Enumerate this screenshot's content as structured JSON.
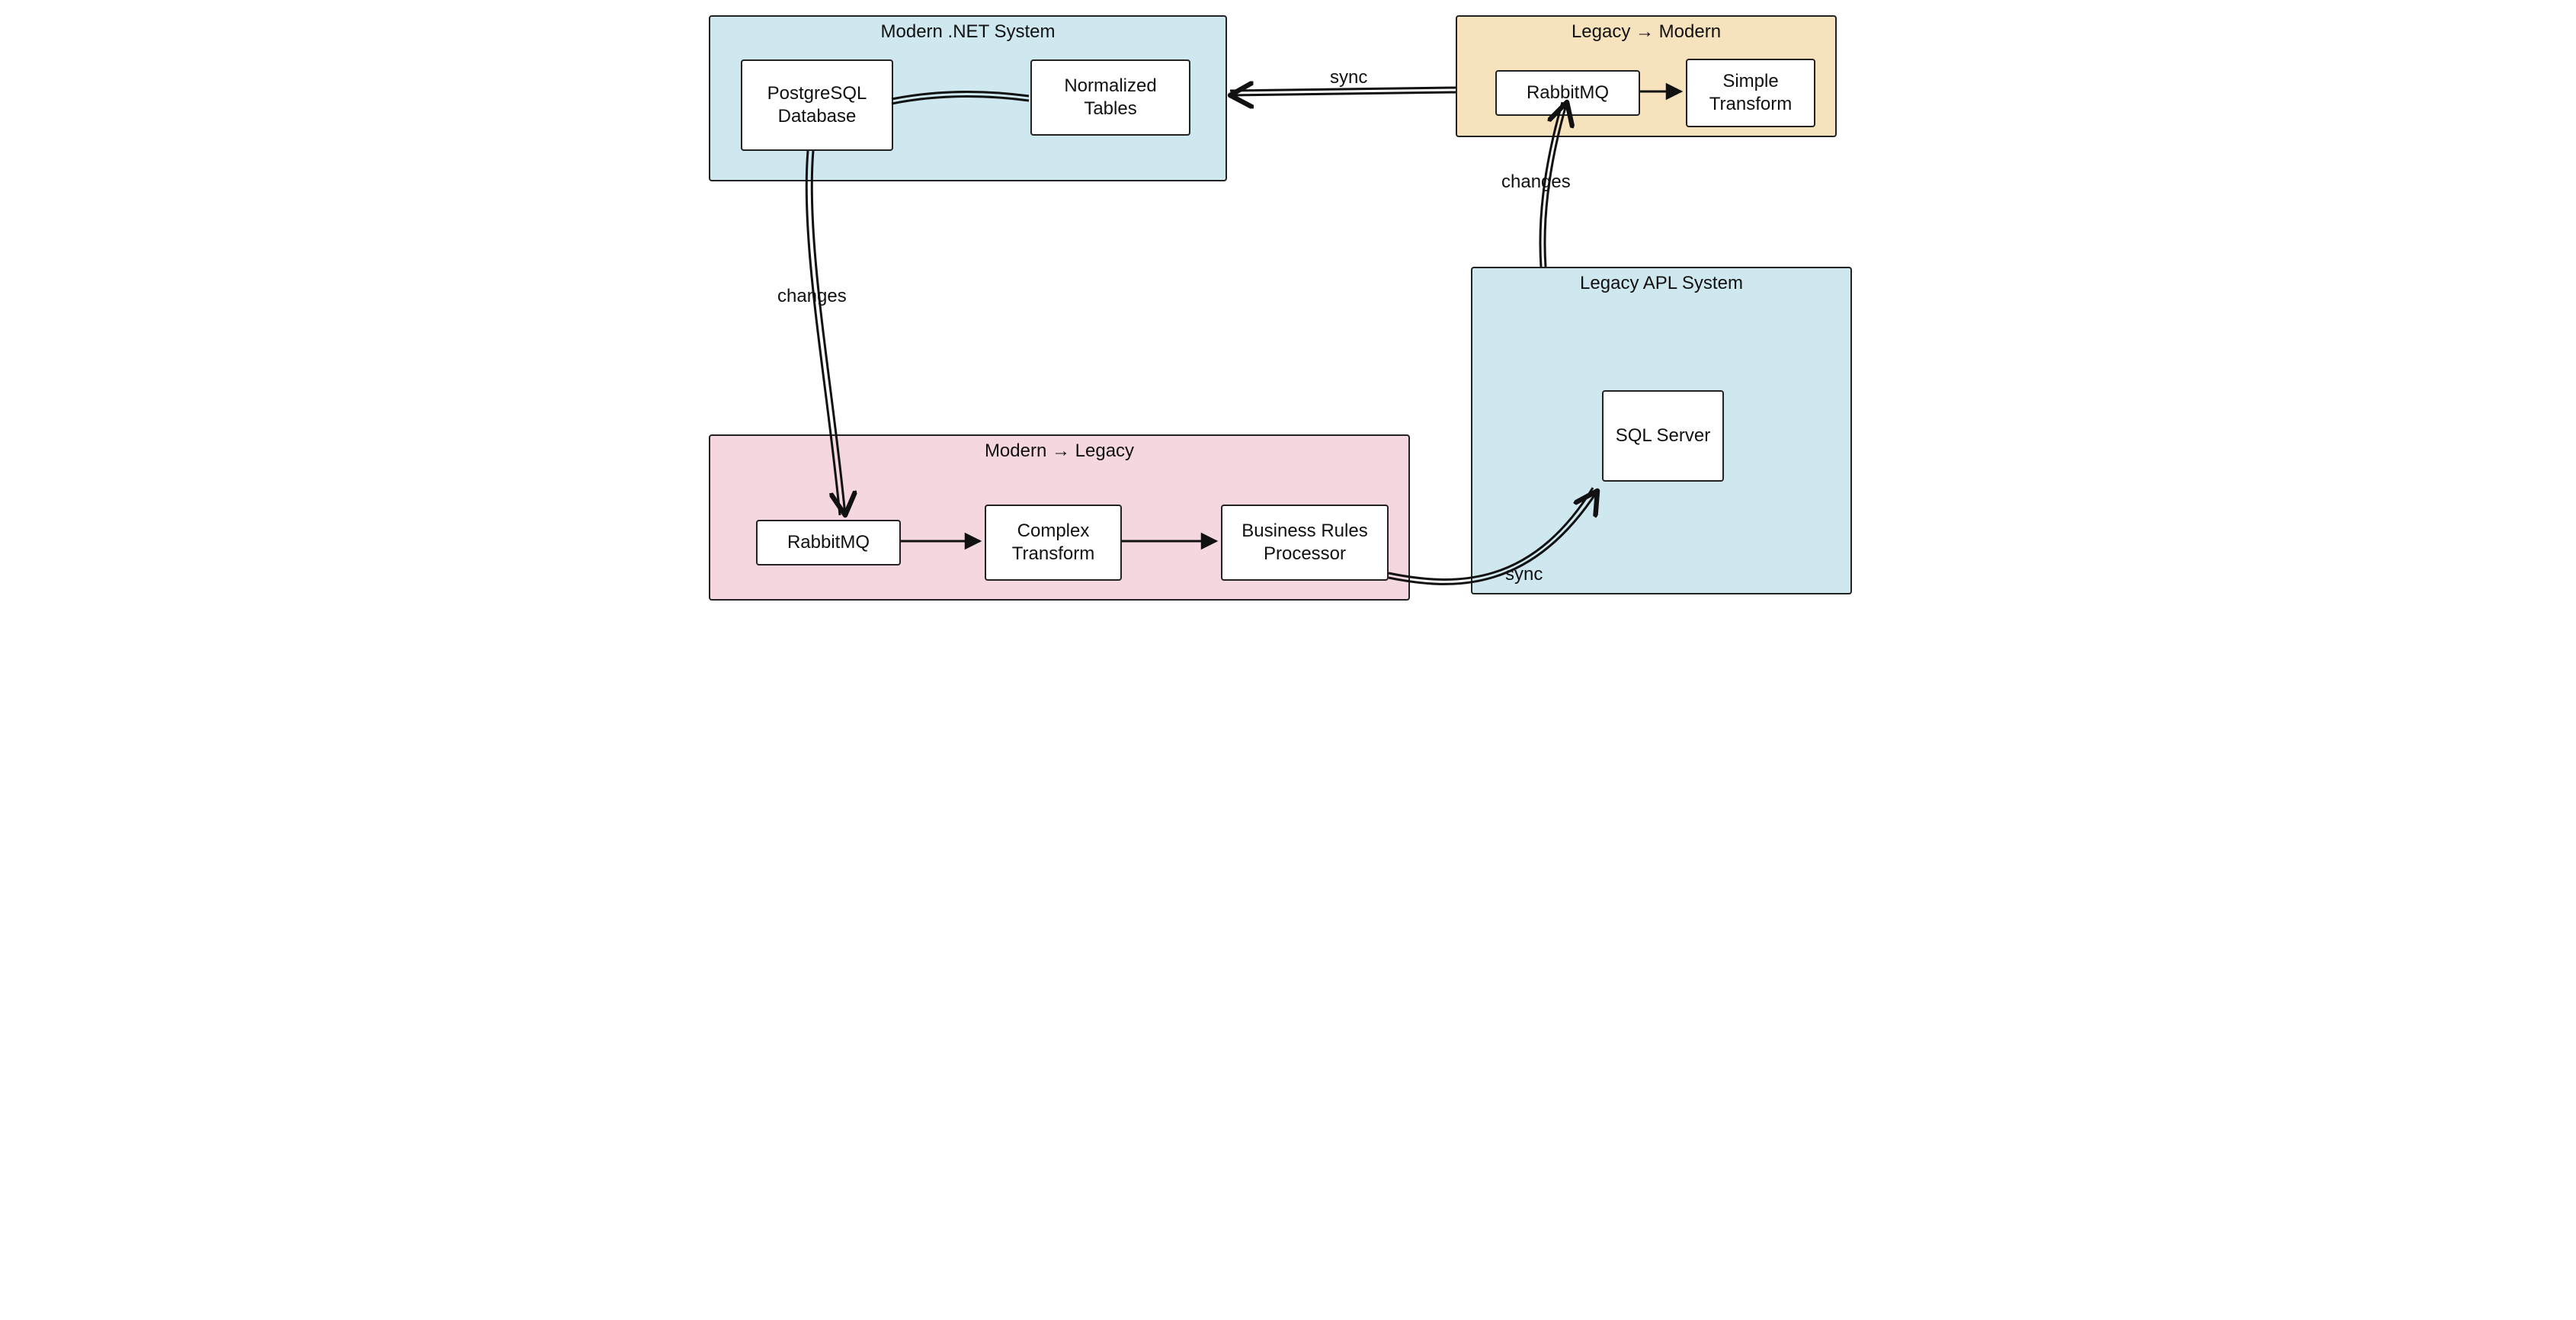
{
  "groups": {
    "modern": {
      "title": "Modern .NET System",
      "nodes": {
        "postgres": "PostgreSQL Database",
        "normalized": "Normalized Tables"
      }
    },
    "mod2leg": {
      "title": "Modern → Legacy",
      "nodes": {
        "rabbit": "RabbitMQ",
        "complex": "Complex Transform",
        "rules": "Business Rules Processor"
      }
    },
    "legacy": {
      "title": "Legacy APL System",
      "nodes": {
        "sqlserver": "SQL Server"
      }
    },
    "leg2mod": {
      "title": "Legacy → Modern",
      "nodes": {
        "rabbit": "RabbitMQ",
        "simple": "Simple Transform"
      }
    }
  },
  "edges": {
    "changes_left": "changes",
    "changes_right": "changes",
    "sync_bottom": "sync",
    "sync_top": "sync"
  }
}
